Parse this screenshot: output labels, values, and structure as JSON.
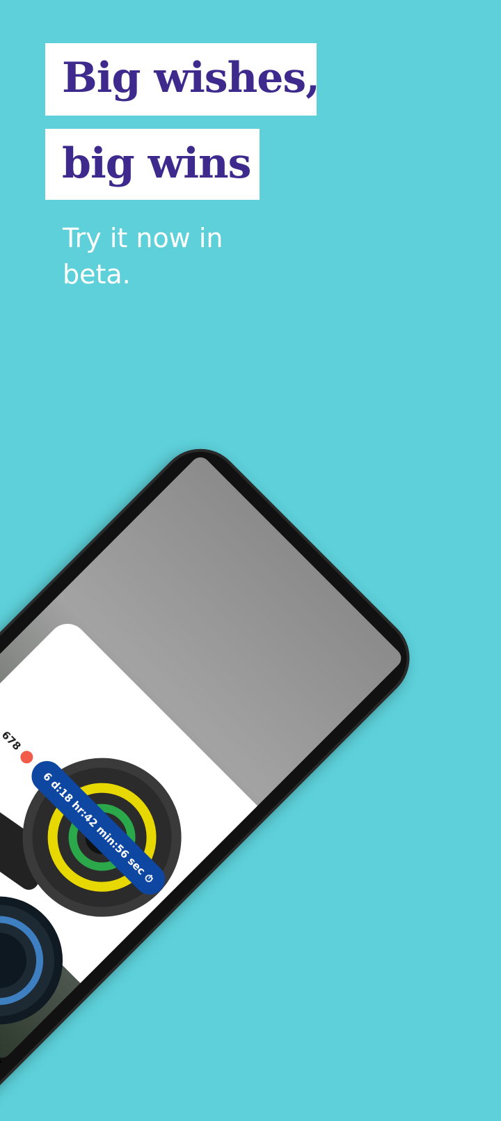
{
  "headline": {
    "line1": "Big wishes,",
    "line2": "big wins"
  },
  "subtitle": "Try it now in beta.",
  "device": {
    "timer_text": "6 d:18 hr:42 min:56 sec",
    "timer_icon": "stopwatch-icon",
    "count_value": "678",
    "count_icon": "red-dot-icon",
    "nav": {
      "back_glyph": "◀",
      "home_glyph": "●",
      "recent_glyph": "■"
    }
  },
  "colors": {
    "background": "#5dd0d9",
    "headline_text": "#3e2a8c",
    "timer_pill": "#0d47a1",
    "count_dot": "#f25a4a"
  }
}
